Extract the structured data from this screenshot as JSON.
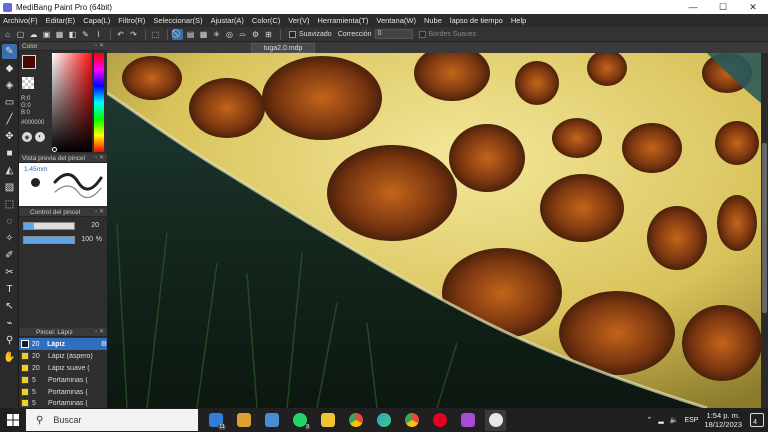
{
  "window": {
    "title": "MediBang Paint Pro (64bit)",
    "minimize": "—",
    "maximize": "☐",
    "close": "✕"
  },
  "menu": [
    "Archivo(F)",
    "Editar(E)",
    "Capa(L)",
    "Filtro(R)",
    "Seleccionar(S)",
    "Ajustar(A)",
    "Color(C)",
    "Ver(V)",
    "Herramienta(T)",
    "Ventana(W)",
    "Nube",
    "lapso de tiempo",
    "Help"
  ],
  "toolbar": {
    "suavizado_label": "Suavizado",
    "correccion_label": "Corrección",
    "correccion_value": "0",
    "bordes_label": "Bordes Suaves"
  },
  "panels": {
    "color": {
      "title": "Color",
      "r": "R:0",
      "g": "G:0",
      "b": "B:0",
      "hex": "#000000"
    },
    "preview": {
      "title": "Vista previa del pincel",
      "size": "1.45mm"
    },
    "control": {
      "title": "Control del pincel",
      "size_value": 20,
      "size_max": 100,
      "opacity_value": "100",
      "opacity_unit": "%",
      "opacity_fraction": 1.0
    },
    "layers": {
      "title": "Pincel: Lápiz",
      "items": [
        {
          "num": "20",
          "name": "Lápiz",
          "selected": true
        },
        {
          "num": "20",
          "name": "Lápiz (áspero)",
          "selected": false
        },
        {
          "num": "20",
          "name": "Lápiz suave (",
          "selected": false
        },
        {
          "num": "5",
          "name": "Portaminas (",
          "selected": false
        },
        {
          "num": "5",
          "name": "Portaminas (",
          "selected": false
        },
        {
          "num": "5",
          "name": "Portaminas (",
          "selected": false
        }
      ]
    }
  },
  "document": {
    "tab": "tuga2.0.mdp"
  },
  "taskbar": {
    "search_placeholder": "Buscar",
    "language": "ESP",
    "time": "1:54 p. m.",
    "date": "18/12/2023",
    "notifications": "4",
    "apps": [
      {
        "icon": "mail-icon",
        "color": "#2f7fd8",
        "badge": "11"
      },
      {
        "icon": "files-icon",
        "color": "#e0a030",
        "badge": ""
      },
      {
        "icon": "keyboard-icon",
        "color": "#4a8bd6",
        "badge": ""
      },
      {
        "icon": "whatsapp-icon",
        "color": "#25d366",
        "badge": "3"
      },
      {
        "icon": "explorer-icon",
        "color": "#f1c232",
        "badge": ""
      },
      {
        "icon": "chrome-icon",
        "color": "#e84a3b",
        "badge": ""
      },
      {
        "icon": "edge-icon",
        "color": "#2aa0c9",
        "badge": ""
      },
      {
        "icon": "chrome-icon",
        "color": "#e84a3b",
        "badge": ""
      },
      {
        "icon": "pinterest-icon",
        "color": "#e60023",
        "badge": ""
      },
      {
        "icon": "app-icon",
        "color": "#a54bd6",
        "badge": ""
      },
      {
        "icon": "medibang-icon",
        "color": "#e8e8e8",
        "badge": ""
      }
    ]
  }
}
